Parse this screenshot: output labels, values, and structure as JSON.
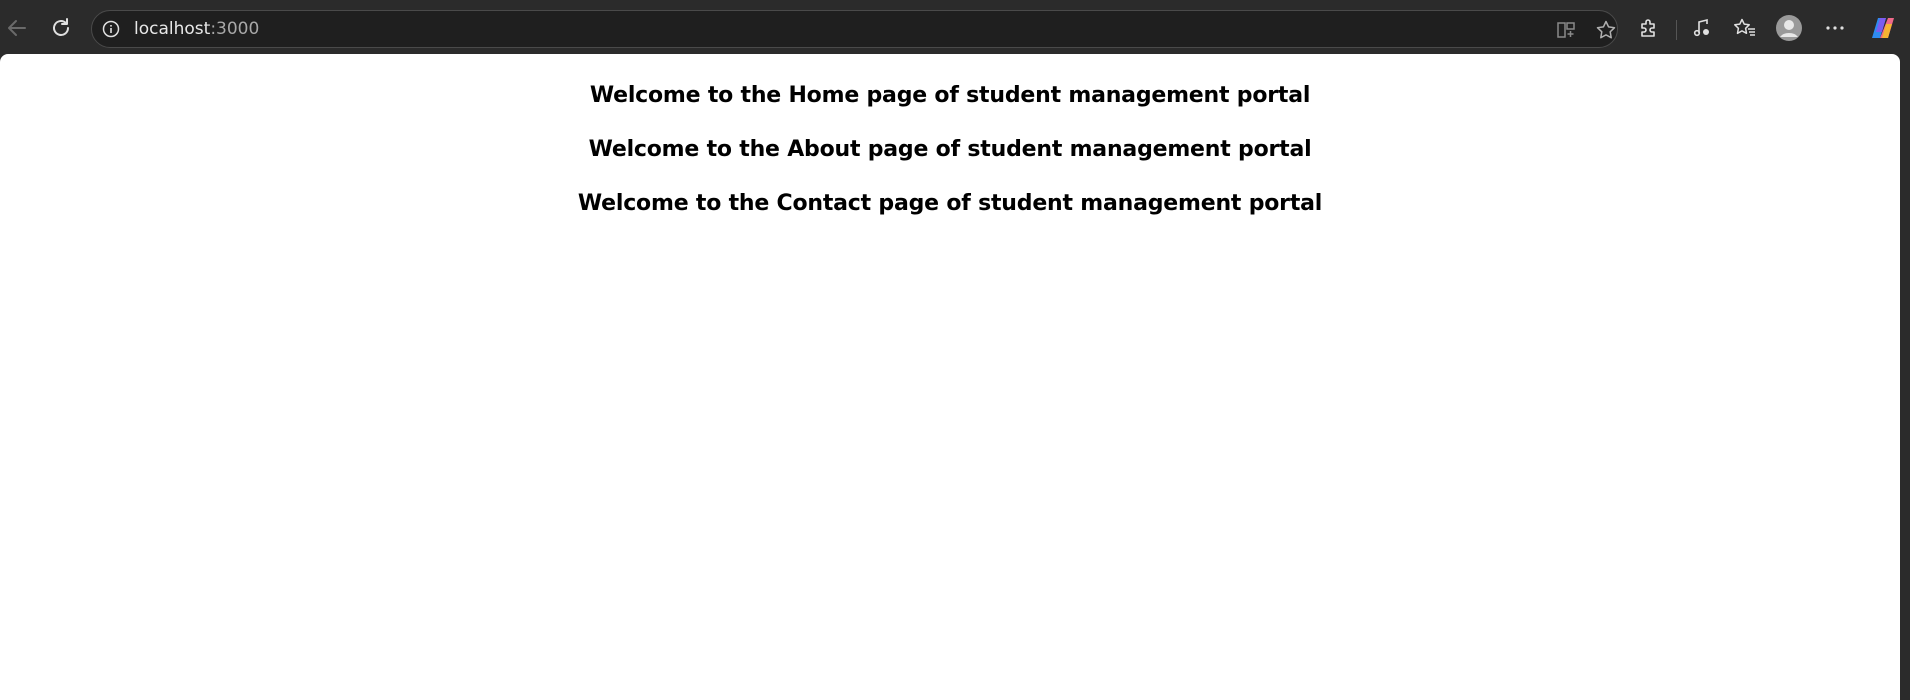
{
  "browser": {
    "address_host": "localhost",
    "address_port": ":3000",
    "icons": {
      "back": "arrow-left-icon",
      "reload": "refresh-icon",
      "site_info": "info-icon",
      "split_screen": "split-screen-icon",
      "favorite": "star-icon",
      "extensions": "puzzle-icon",
      "media": "music-note-icon",
      "favorites": "favorites-list-icon",
      "profile": "avatar-icon",
      "menu": "more-icon",
      "copilot": "copilot-icon"
    }
  },
  "page": {
    "headings": [
      "Welcome to the Home page of student management portal",
      "Welcome to the About page of student management portal",
      "Welcome to the Contact page of student management portal"
    ]
  }
}
